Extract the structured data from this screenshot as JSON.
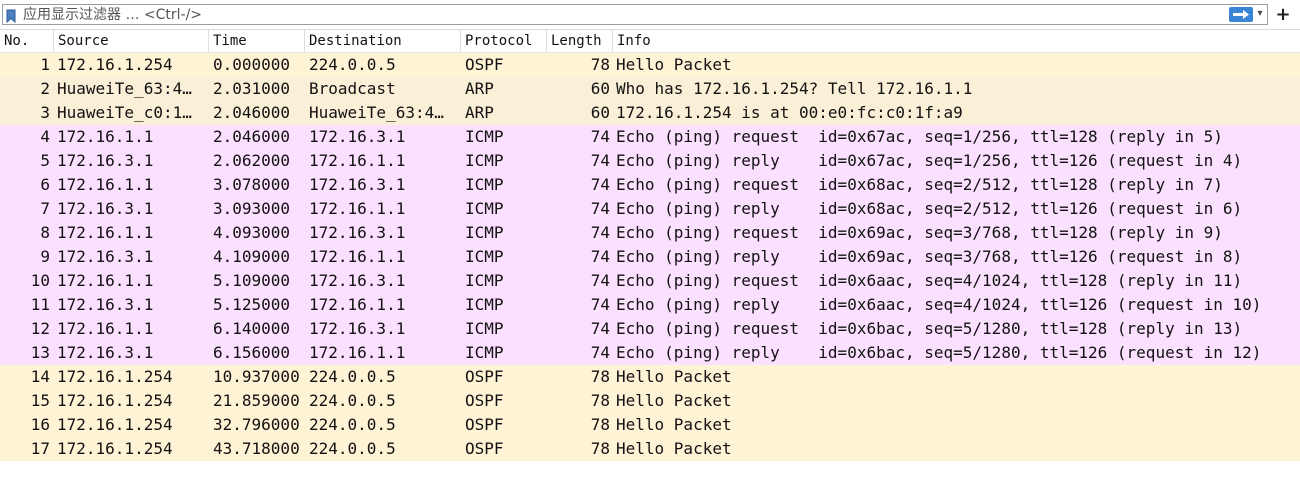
{
  "filter": {
    "placeholder": "应用显示过滤器 … <Ctrl-/>",
    "add_label": "+"
  },
  "columns": [
    "No.",
    "Source",
    "Time",
    "Destination",
    "Protocol",
    "Length",
    "Info"
  ],
  "colors": {
    "ospf": "#fff3d6",
    "arp": "#faf0d7",
    "icmp": "#fce0ff",
    "apply_button": "#3a86d6"
  },
  "packets": [
    {
      "no": "1",
      "source": "172.16.1.254",
      "time": "0.000000",
      "destination": "224.0.0.5",
      "protocol": "OSPF",
      "length": "78",
      "info": "Hello Packet",
      "color": "ospf"
    },
    {
      "no": "2",
      "source": "HuaweiTe_63:4…",
      "time": "2.031000",
      "destination": "Broadcast",
      "protocol": "ARP",
      "length": "60",
      "info": "Who has 172.16.1.254? Tell 172.16.1.1",
      "color": "arp"
    },
    {
      "no": "3",
      "source": "HuaweiTe_c0:1…",
      "time": "2.046000",
      "destination": "HuaweiTe_63:4…",
      "protocol": "ARP",
      "length": "60",
      "info": "172.16.1.254 is at 00:e0:fc:c0:1f:a9",
      "color": "arp"
    },
    {
      "no": "4",
      "source": "172.16.1.1",
      "time": "2.046000",
      "destination": "172.16.3.1",
      "protocol": "ICMP",
      "length": "74",
      "info": "Echo (ping) request  id=0x67ac, seq=1/256, ttl=128 (reply in 5)",
      "color": "icmp"
    },
    {
      "no": "5",
      "source": "172.16.3.1",
      "time": "2.062000",
      "destination": "172.16.1.1",
      "protocol": "ICMP",
      "length": "74",
      "info": "Echo (ping) reply    id=0x67ac, seq=1/256, ttl=126 (request in 4)",
      "color": "icmp"
    },
    {
      "no": "6",
      "source": "172.16.1.1",
      "time": "3.078000",
      "destination": "172.16.3.1",
      "protocol": "ICMP",
      "length": "74",
      "info": "Echo (ping) request  id=0x68ac, seq=2/512, ttl=128 (reply in 7)",
      "color": "icmp"
    },
    {
      "no": "7",
      "source": "172.16.3.1",
      "time": "3.093000",
      "destination": "172.16.1.1",
      "protocol": "ICMP",
      "length": "74",
      "info": "Echo (ping) reply    id=0x68ac, seq=2/512, ttl=126 (request in 6)",
      "color": "icmp"
    },
    {
      "no": "8",
      "source": "172.16.1.1",
      "time": "4.093000",
      "destination": "172.16.3.1",
      "protocol": "ICMP",
      "length": "74",
      "info": "Echo (ping) request  id=0x69ac, seq=3/768, ttl=128 (reply in 9)",
      "color": "icmp"
    },
    {
      "no": "9",
      "source": "172.16.3.1",
      "time": "4.109000",
      "destination": "172.16.1.1",
      "protocol": "ICMP",
      "length": "74",
      "info": "Echo (ping) reply    id=0x69ac, seq=3/768, ttl=126 (request in 8)",
      "color": "icmp"
    },
    {
      "no": "10",
      "source": "172.16.1.1",
      "time": "5.109000",
      "destination": "172.16.3.1",
      "protocol": "ICMP",
      "length": "74",
      "info": "Echo (ping) request  id=0x6aac, seq=4/1024, ttl=128 (reply in 11)",
      "color": "icmp"
    },
    {
      "no": "11",
      "source": "172.16.3.1",
      "time": "5.125000",
      "destination": "172.16.1.1",
      "protocol": "ICMP",
      "length": "74",
      "info": "Echo (ping) reply    id=0x6aac, seq=4/1024, ttl=126 (request in 10)",
      "color": "icmp"
    },
    {
      "no": "12",
      "source": "172.16.1.1",
      "time": "6.140000",
      "destination": "172.16.3.1",
      "protocol": "ICMP",
      "length": "74",
      "info": "Echo (ping) request  id=0x6bac, seq=5/1280, ttl=128 (reply in 13)",
      "color": "icmp"
    },
    {
      "no": "13",
      "source": "172.16.3.1",
      "time": "6.156000",
      "destination": "172.16.1.1",
      "protocol": "ICMP",
      "length": "74",
      "info": "Echo (ping) reply    id=0x6bac, seq=5/1280, ttl=126 (request in 12)",
      "color": "icmp"
    },
    {
      "no": "14",
      "source": "172.16.1.254",
      "time": "10.937000",
      "destination": "224.0.0.5",
      "protocol": "OSPF",
      "length": "78",
      "info": "Hello Packet",
      "color": "ospf"
    },
    {
      "no": "15",
      "source": "172.16.1.254",
      "time": "21.859000",
      "destination": "224.0.0.5",
      "protocol": "OSPF",
      "length": "78",
      "info": "Hello Packet",
      "color": "ospf"
    },
    {
      "no": "16",
      "source": "172.16.1.254",
      "time": "32.796000",
      "destination": "224.0.0.5",
      "protocol": "OSPF",
      "length": "78",
      "info": "Hello Packet",
      "color": "ospf"
    },
    {
      "no": "17",
      "source": "172.16.1.254",
      "time": "43.718000",
      "destination": "224.0.0.5",
      "protocol": "OSPF",
      "length": "78",
      "info": "Hello Packet",
      "color": "ospf"
    }
  ]
}
